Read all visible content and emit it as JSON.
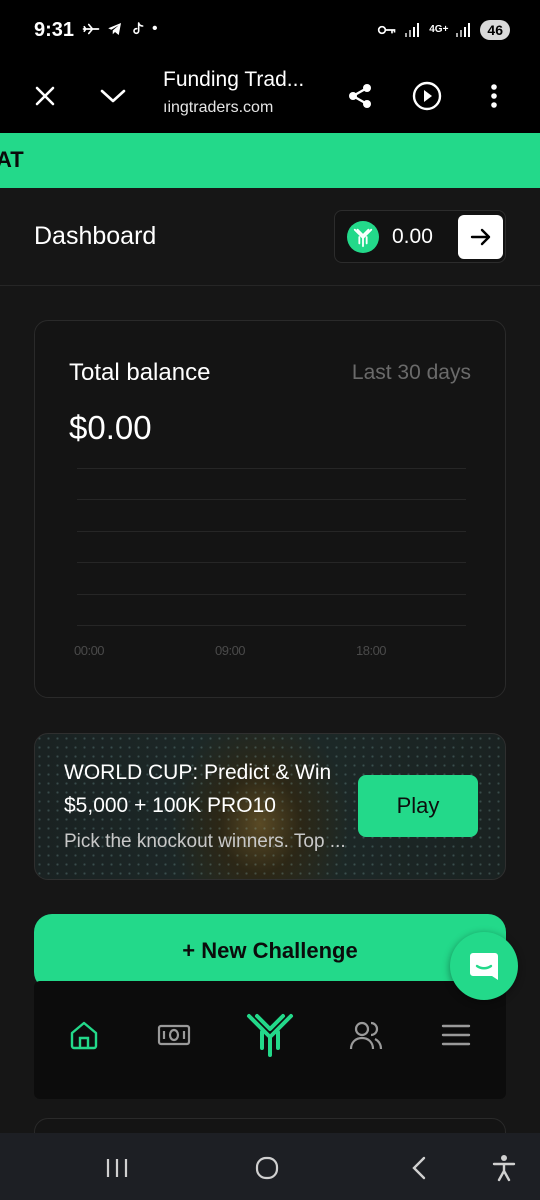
{
  "status_bar": {
    "time": "9:31",
    "dot": "•",
    "network": "4G+",
    "battery": "46"
  },
  "browser": {
    "title": "Funding Trad...",
    "url": "ıingtraders.com"
  },
  "banner": {
    "text": "AT"
  },
  "dashboard": {
    "title": "Dashboard",
    "wallet_amount": "0.00"
  },
  "balance_card": {
    "title": "Total balance",
    "range": "Last 30 days",
    "value": "$0.00",
    "ticks": [
      "00:00",
      "09:00",
      "18:00"
    ]
  },
  "promo": {
    "line1": "WORLD CUP: Predict & Win",
    "line2": "$5,000 + 100K PRO10",
    "description": "Pick the knockout winners. Top ...",
    "button": "Play"
  },
  "new_challenge": {
    "label": "+ New Challenge"
  },
  "colors": {
    "accent": "#23d98a",
    "background": "#161616",
    "card": "#141414"
  },
  "icons": {
    "nav": [
      "home-icon",
      "cash-icon",
      "logo-icon",
      "users-icon",
      "menu-icon"
    ],
    "chat": "chat-icon"
  }
}
